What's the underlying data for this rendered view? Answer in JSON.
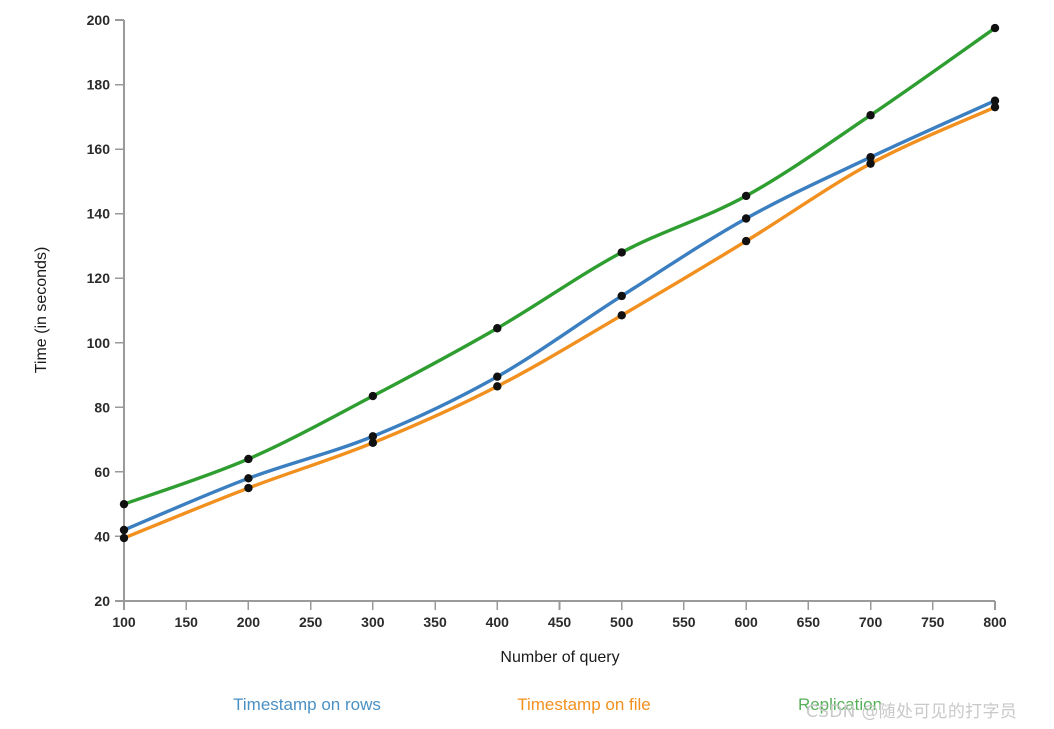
{
  "chart_data": {
    "type": "line",
    "title": "",
    "xlabel": "Number of query",
    "ylabel": "Time (in seconds)",
    "x": [
      100,
      200,
      300,
      400,
      500,
      600,
      700,
      800
    ],
    "xlim": [
      100,
      800
    ],
    "ylim": [
      20,
      200
    ],
    "xticks": [
      100,
      150,
      200,
      250,
      300,
      350,
      400,
      450,
      500,
      550,
      600,
      650,
      700,
      750,
      800
    ],
    "yticks": [
      20,
      40,
      60,
      80,
      100,
      120,
      140,
      160,
      180,
      200
    ],
    "grid": false,
    "legend_position": "bottom",
    "marker": "circle",
    "marker_color": "#111111",
    "interpolation": "smooth",
    "series": [
      {
        "name": "Timestamp on rows",
        "color": "#3b7fc0",
        "values": [
          42,
          58,
          71,
          89.5,
          114.5,
          138.5,
          157.5,
          175
        ]
      },
      {
        "name": "Timestamp on file",
        "color": "#f2901f",
        "values": [
          39.5,
          55,
          69,
          86.5,
          108.5,
          131.5,
          155.5,
          173
        ]
      },
      {
        "name": "Replication",
        "color": "#2f9e31",
        "values": [
          50,
          64,
          83.5,
          104.5,
          128,
          145.5,
          170.5,
          197.5
        ]
      }
    ]
  },
  "axis": {
    "x_title": "Number of query",
    "y_title": "Time (in seconds)",
    "spine_color": "#9a9a9a",
    "tick_label_color": "#2b2b2b"
  },
  "legend": {
    "items": [
      {
        "label": "Timestamp on rows",
        "color": "#4a90c4"
      },
      {
        "label": "Timestamp on file",
        "color": "#f2901f"
      },
      {
        "label": "Replication",
        "color": "#56b05a"
      }
    ]
  },
  "watermark": {
    "text": "CSDN @随处可见的打字员",
    "color": "#c9c9c9"
  }
}
